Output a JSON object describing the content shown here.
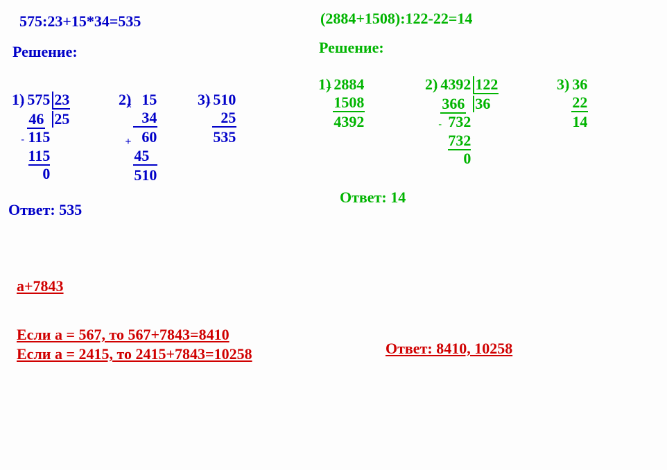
{
  "problem1": {
    "equation": "575:23+15*34=535",
    "solution_label": "Решение:",
    "steps": {
      "s1": {
        "num": "1)",
        "dividend": "575",
        "divisor": "23",
        "quotient": "25",
        "line1": "46",
        "rem1": "115",
        "line2": "115",
        "rem2": "0",
        "minus": "-"
      },
      "s2": {
        "num": "2)",
        "a": "15",
        "b": "34",
        "p1": "60",
        "p2": "45",
        "result": "510",
        "times": "×",
        "plus": "+"
      },
      "s3": {
        "num": "3)",
        "a": "510",
        "b": "25",
        "result": "535",
        "plus": "+"
      }
    },
    "answer_label": "Ответ: 535"
  },
  "problem2": {
    "equation": "(2884+1508):122-22=14",
    "solution_label": "Решение:",
    "steps": {
      "s1": {
        "num": "1)",
        "a": "2884",
        "b": "1508",
        "result": "4392",
        "plus": "+"
      },
      "s2": {
        "num": "2)",
        "dividend": "4392",
        "divisor": "122",
        "quotient": "36",
        "line1": "366",
        "rem1": "732",
        "line2": "732",
        "rem2": "0",
        "minus1": "-",
        "minus2": "-"
      },
      "s3": {
        "num": "3)",
        "a": "36",
        "b": "22",
        "result": "14",
        "minus": "-"
      }
    },
    "answer_label": "Ответ: 14"
  },
  "problem3": {
    "expression": "а+7843",
    "line1": "Если а = 567, то 567+7843=8410",
    "line2": "Если а = 2415, то 2415+7843=10258",
    "answer_label": "Ответ: 8410, 10258"
  }
}
